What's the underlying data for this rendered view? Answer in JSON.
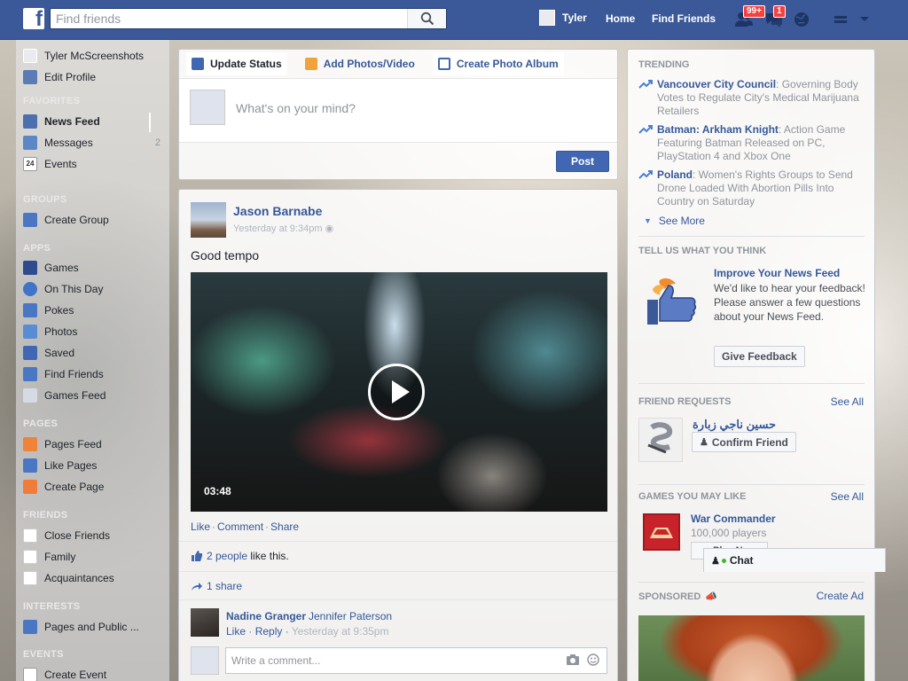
{
  "topbar": {
    "logo": "f",
    "search_placeholder": "Find friends",
    "user_name": "Tyler",
    "home": "Home",
    "find_friends": "Find Friends",
    "friend_requests_badge": "99+",
    "messages_badge": "1",
    "brand_color": "#3b5998"
  },
  "leftnav": {
    "profile_name": "Tyler McScreenshots",
    "edit_profile": "Edit Profile",
    "favorites_header": "FAVORITES",
    "news_feed": "News Feed",
    "messages": "Messages",
    "messages_count": "2",
    "events": "Events",
    "events_icon_text": "24",
    "groups_header": "GROUPS",
    "create_group": "Create Group",
    "apps_header": "APPS",
    "games": "Games",
    "on_this_day": "On This Day",
    "pokes": "Pokes",
    "photos": "Photos",
    "saved": "Saved",
    "find_friends": "Find Friends",
    "games_feed": "Games Feed",
    "pages_header": "PAGES",
    "pages_feed": "Pages Feed",
    "like_pages": "Like Pages",
    "create_page": "Create Page",
    "friends_header": "FRIENDS",
    "close_friends": "Close Friends",
    "family": "Family",
    "acquaintances": "Acquaintances",
    "interests_header": "INTERESTS",
    "pages_public": "Pages and Public ...",
    "events_header": "EVENTS",
    "create_event": "Create Event"
  },
  "composer": {
    "tab_update": "Update Status",
    "tab_photos": "Add Photos/Video",
    "tab_album": "Create Photo Album",
    "placeholder": "What's on your mind?",
    "post_button": "Post"
  },
  "post": {
    "author": "Jason Barnabe",
    "time": "Yesterday at 9:34pm",
    "text": "Good tempo",
    "video_duration": "03:48",
    "action_like": "Like",
    "action_comment": "Comment",
    "action_share": "Share",
    "likes_link": "2 people",
    "likes_suffix": "like this.",
    "shares": "1 share",
    "comment_author": "Nadine Granger",
    "comment_tag": "Jennifer Paterson",
    "comment_like": "Like",
    "comment_reply": "Reply",
    "comment_time": "Yesterday at 9:35pm",
    "write_comment_placeholder": "Write a comment..."
  },
  "right": {
    "trending_header": "TRENDING",
    "trending": [
      {
        "topic": "Vancouver City Council",
        "desc": ": Governing Body Votes to Regulate City's Medical Marijuana Retailers"
      },
      {
        "topic": "Batman: Arkham Knight",
        "desc": ": Action Game Featuring Batman Released on PC, PlayStation 4 and Xbox One"
      },
      {
        "topic": "Poland",
        "desc": ": Women's Rights Groups to Send Drone Loaded With Abortion Pills Into Country on Saturday"
      }
    ],
    "see_more": "See More",
    "tell_us_header": "TELL US WHAT YOU THINK",
    "feedback_title": "Improve Your News Feed",
    "feedback_text": "We'd like to hear your feedback! Please answer a few questions about your News Feed.",
    "give_feedback": "Give Feedback",
    "friend_requests_header": "FRIEND REQUESTS",
    "see_all_friends": "See All",
    "friend_name": "حسين ناجي زبارة",
    "confirm_friend": "Confirm Friend",
    "games_header": "GAMES YOU MAY LIKE",
    "see_all_games": "See All",
    "game_name": "War Commander",
    "game_players": "100,000 players",
    "play_now": "Play Now",
    "sponsored_header": "SPONSORED",
    "create_ad": "Create Ad"
  },
  "chat": {
    "label": "Chat"
  }
}
